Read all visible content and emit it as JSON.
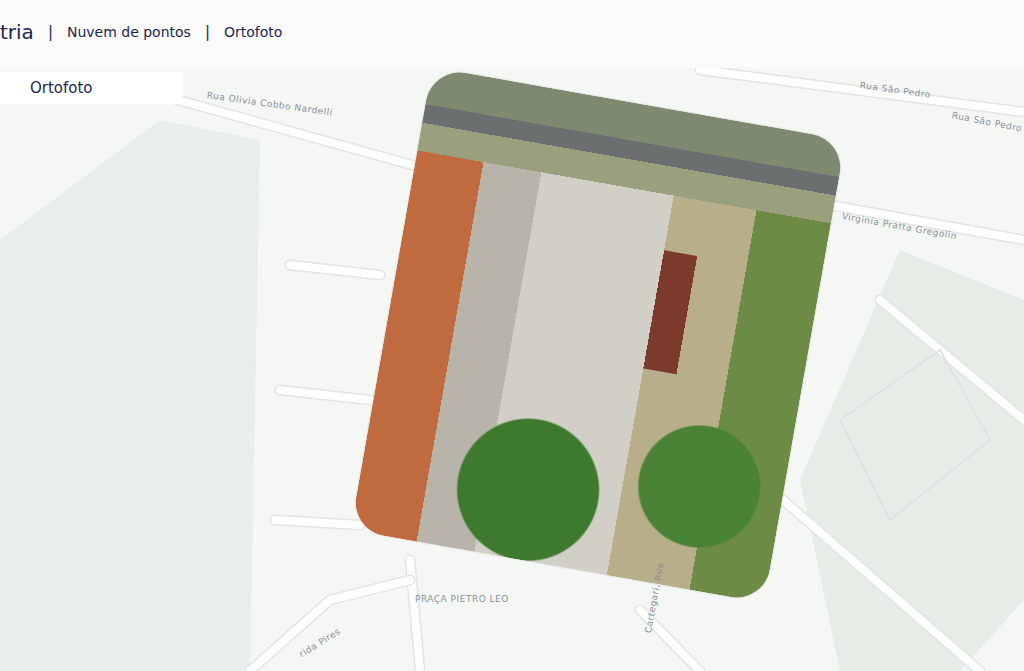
{
  "header": {
    "brand": "tria",
    "separator": "|",
    "links": [
      {
        "label": "Nuvem de pontos"
      },
      {
        "label": "Ortofoto"
      }
    ]
  },
  "layer_panel": {
    "label": "Ortofoto"
  },
  "map": {
    "streets": [
      {
        "name": "Rua Olivia Cobbo Nardelli"
      },
      {
        "name": "Rua São Pedro"
      },
      {
        "name": "Rua São Pedro"
      },
      {
        "name": "Virginia Pratta Gregolin"
      },
      {
        "name": "PRAÇA PIETRO LEO"
      },
      {
        "name": "Cartegari, Rua"
      },
      {
        "name": "rida Pires"
      }
    ]
  }
}
